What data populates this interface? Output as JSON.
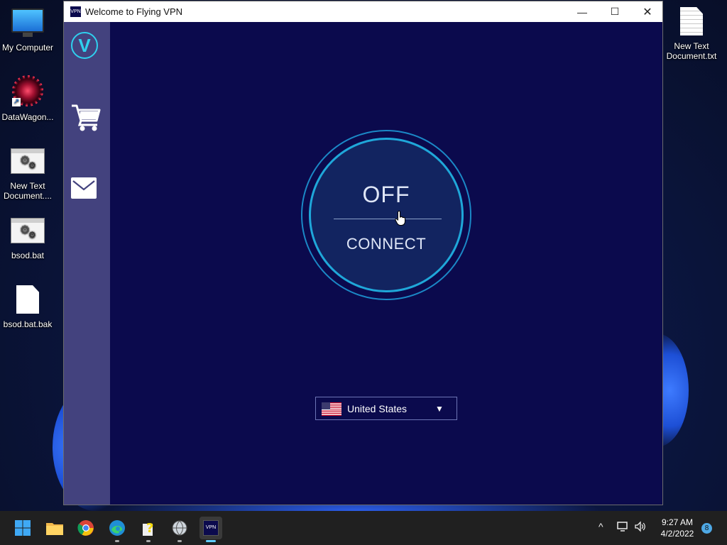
{
  "desktop": {
    "icons": [
      {
        "label": "My Computer"
      },
      {
        "label": "DataWagon..."
      },
      {
        "label": "New Text Document...."
      },
      {
        "label": "bsod.bat"
      },
      {
        "label": "bsod.bat.bak"
      },
      {
        "label": "New Text Document.txt"
      }
    ]
  },
  "window": {
    "title": "Welcome to Flying VPN",
    "app_icon_text": "VPN",
    "controls": {
      "minimize": "—",
      "maximize": "☐",
      "close": "✕"
    }
  },
  "sidebar": {
    "logo_letter": "V",
    "items": [
      {
        "icon": "cart-icon"
      },
      {
        "icon": "mail-icon"
      }
    ]
  },
  "vpn": {
    "state": "OFF",
    "action": "CONNECT",
    "location": "United States",
    "accent_color": "#1fa7d9",
    "background_color": "#0b0a4d",
    "sidebar_color": "#43427e"
  },
  "taskbar": {
    "apps": [
      "start-icon",
      "file-explorer-icon",
      "chrome-icon",
      "edge-icon",
      "help-script-icon",
      "globe-icon",
      "vpn-app-icon"
    ],
    "time": "9:27 AM",
    "date": "4/2/2022",
    "notification_count": "8",
    "tray_chevron": "^"
  }
}
